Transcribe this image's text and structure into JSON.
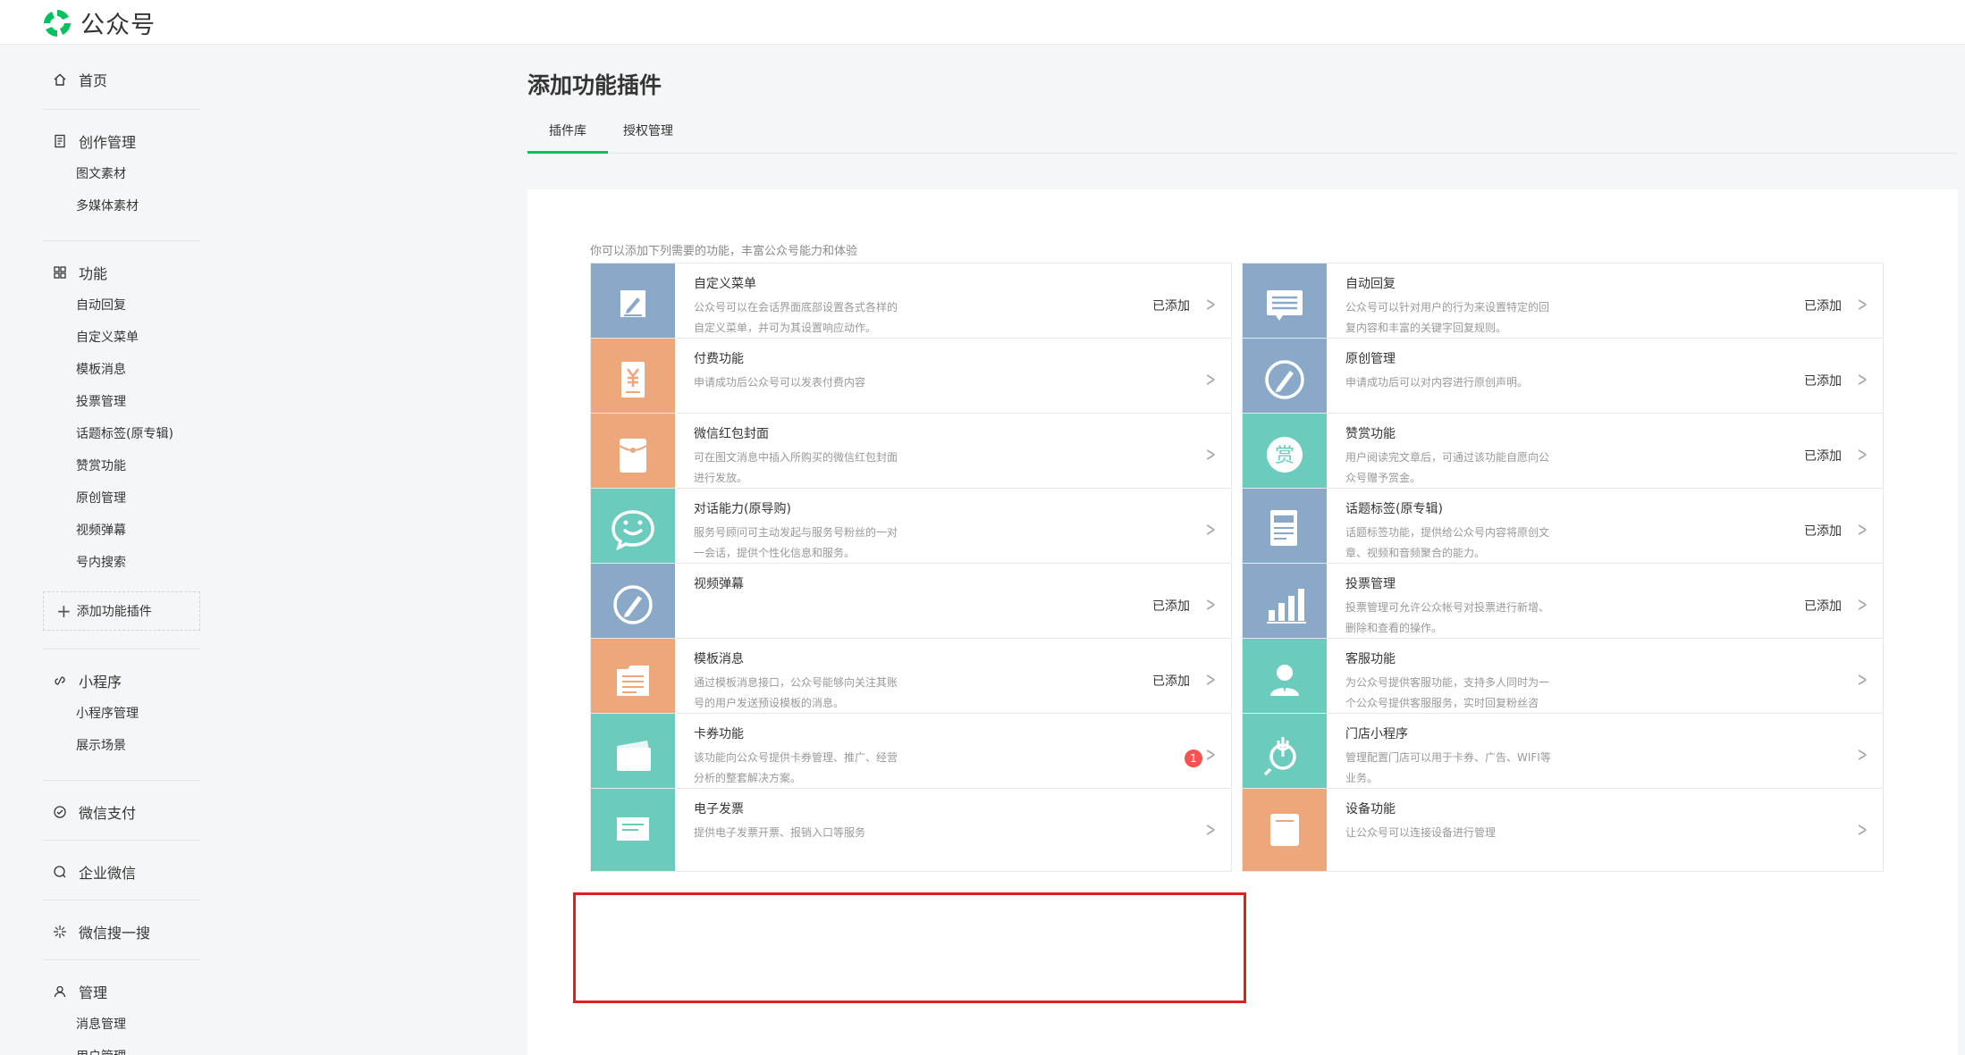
{
  "app": {
    "title": "公众号",
    "brand_color": "#07c160"
  },
  "sidebar": {
    "sections": [
      {
        "title": "首页",
        "icon": "home-icon",
        "items": []
      },
      {
        "title": "创作管理",
        "icon": "document-icon",
        "items": [
          "图文素材",
          "多媒体素材"
        ]
      },
      {
        "title": "功能",
        "icon": "grid-icon",
        "items": [
          "自动回复",
          "自定义菜单",
          "模板消息",
          "投票管理",
          "话题标签(原专辑)",
          "赞赏功能",
          "原创管理",
          "视频弹幕",
          "号内搜索"
        ],
        "add_label": "添加功能插件"
      },
      {
        "title": "小程序",
        "icon": "link-icon",
        "items": [
          "小程序管理",
          "展示场景"
        ]
      },
      {
        "title": "微信支付",
        "icon": "pay-icon",
        "items": []
      },
      {
        "title": "企业微信",
        "icon": "work-wechat-icon",
        "items": []
      },
      {
        "title": "微信搜一搜",
        "icon": "sparkle-icon",
        "items": []
      },
      {
        "title": "管理",
        "icon": "user-manage-icon",
        "items": [
          "消息管理",
          "用户管理"
        ]
      }
    ]
  },
  "main": {
    "title": "添加功能插件",
    "tabs": [
      "插件库",
      "授权管理"
    ],
    "tip": "你可以添加下列需要的功能，丰富公众号能力和体验"
  },
  "plugins": [
    {
      "name": "自定义菜单",
      "desc": "公众号可以在会话界面底部设置各式各样的自定义菜单，并可为其设置响应动作。",
      "status": "已添加",
      "icon": "pencil-icon",
      "color": "blue"
    },
    {
      "name": "自动回复",
      "desc": "公众号可以针对用户的行为来设置特定的回复内容和丰富的关键字回复规则。",
      "status": "已添加",
      "icon": "message-icon",
      "color": "blue"
    },
    {
      "name": "付费功能",
      "desc": "申请成功后公众号可以发表付费内容",
      "status": "",
      "icon": "yuan-icon",
      "color": "orange"
    },
    {
      "name": "原创管理",
      "desc": "申请成功后可以对内容进行原创声明。",
      "status": "已添加",
      "icon": "compass-pen-icon",
      "color": "blue"
    },
    {
      "name": "微信红包封面",
      "desc": "可在图文消息中插入所购买的微信红包封面进行发放。",
      "status": "",
      "icon": "red-packet-icon",
      "color": "orange"
    },
    {
      "name": "赞赏功能",
      "desc": "用户阅读完文章后，可通过该功能自愿向公众号赠予赏金。",
      "status": "已添加",
      "icon": "reward-icon",
      "color": "teal"
    },
    {
      "name": "对话能力(原导购)",
      "desc": "服务号顾问可主动发起与服务号粉丝的一对一会话，提供个性化信息和服务。",
      "status": "",
      "icon": "chat-smile-icon",
      "color": "teal"
    },
    {
      "name": "话题标签(原专辑)",
      "desc": "话题标签功能，提供给公众号内容将原创文章、视频和音频聚合的能力。",
      "status": "已添加",
      "icon": "album-icon",
      "color": "blue"
    },
    {
      "name": "视频弹幕",
      "desc": "",
      "status": "已添加",
      "icon": "compass-pen-icon",
      "color": "blue"
    },
    {
      "name": "投票管理",
      "desc": "投票管理可允许公众帐号对投票进行新增、删除和查看的操作。",
      "status": "已添加",
      "icon": "bar-chart-icon",
      "color": "blue"
    },
    {
      "name": "模板消息",
      "desc": "通过模板消息接口，公众号能够向关注其账号的用户发送预设模板的消息。",
      "status": "已添加",
      "icon": "template-icon",
      "color": "orange"
    },
    {
      "name": "客服功能",
      "desc": "为公众号提供客服功能，支持多人同时为一个公众号提供客服服务，实时回复粉丝咨",
      "status": "",
      "icon": "customer-service-icon",
      "color": "teal"
    },
    {
      "name": "卡券功能",
      "desc": "该功能向公众号提供卡券管理、推广、经营分析的整套解决方案。",
      "status": "",
      "badge": "1",
      "icon": "card-icon",
      "color": "teal"
    },
    {
      "name": "门店小程序",
      "desc": "管理配置门店可以用于卡券、广告、WIFI等业务。",
      "status": "",
      "icon": "store-icon",
      "color": "teal"
    },
    {
      "name": "电子发票",
      "desc": "提供电子发票开票、报销入口等服务",
      "status": "",
      "icon": "invoice-icon",
      "color": "teal"
    },
    {
      "name": "设备功能",
      "desc": "让公众号可以连接设备进行管理",
      "status": "",
      "icon": "device-icon",
      "color": "orange"
    }
  ]
}
